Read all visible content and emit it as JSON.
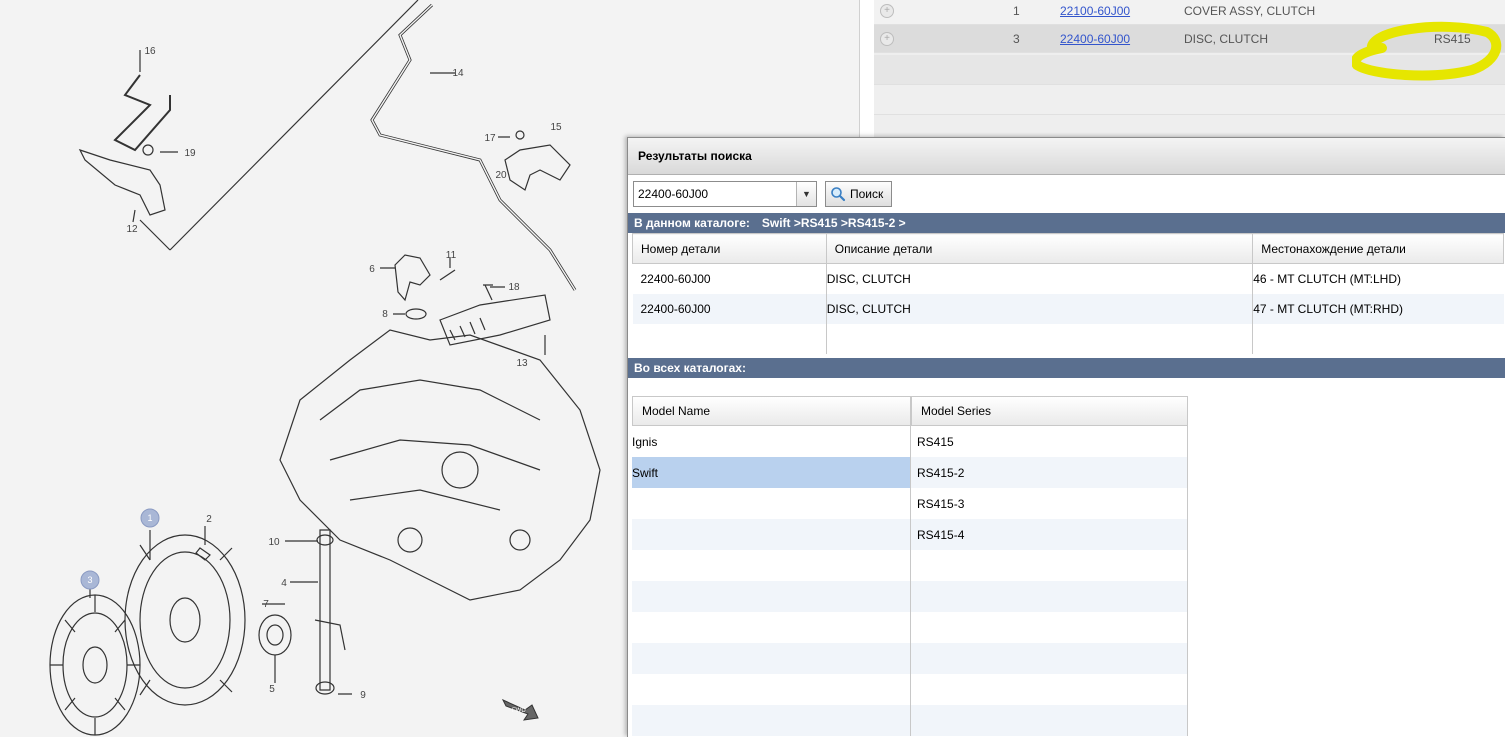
{
  "diagram": {
    "callouts": [
      "16",
      "14",
      "15",
      "17",
      "19",
      "20",
      "12",
      "11",
      "6",
      "18",
      "8",
      "13",
      "1",
      "2",
      "10",
      "3",
      "4",
      "7",
      "5",
      "9"
    ],
    "fwd_label": "FWD"
  },
  "parts_panel": {
    "rows": [
      {
        "qty": "1",
        "part_no": "22100-60J00",
        "description": "COVER ASSY, CLUTCH",
        "model": ""
      },
      {
        "qty": "3",
        "part_no": "22400-60J00",
        "description": "DISC, CLUTCH",
        "model": "RS415"
      }
    ],
    "highlight_color": "#e6e600"
  },
  "search_dialog": {
    "title": "Результаты поиска",
    "query_value": "22400-60J00",
    "search_button_label": "Поиск",
    "this_catalog": {
      "label": "В данном каталоге:",
      "path": "Swift >RS415 >RS415-2 >",
      "columns": [
        "Номер детали",
        "Описание детали",
        "Местонахождение детали"
      ],
      "rows": [
        {
          "part_no": "22400-60J00",
          "description": "DISC, CLUTCH",
          "location": "46 - MT CLUTCH (MT:LHD)"
        },
        {
          "part_no": "22400-60J00",
          "description": "DISC, CLUTCH",
          "location": "47 - MT CLUTCH (MT:RHD)"
        }
      ]
    },
    "all_catalogs": {
      "label": "Во всех каталогах:",
      "columns": [
        "Model Name",
        "Model Series"
      ],
      "model_names": [
        "Ignis",
        "Swift"
      ],
      "model_series": [
        "RS415",
        "RS415-2",
        "RS415-3",
        "RS415-4"
      ],
      "selected_model": "Swift"
    },
    "header_color": "#5a6f8f",
    "selection_color": "#b9d1ee"
  }
}
